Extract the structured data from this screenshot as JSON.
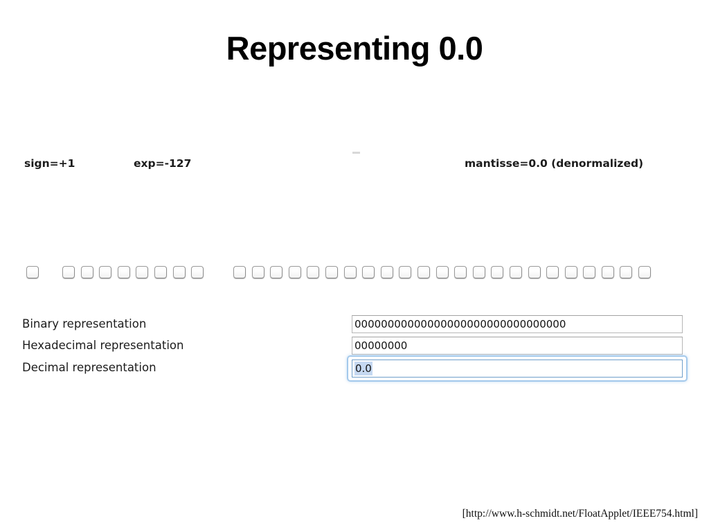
{
  "slide": {
    "title": "Representing 0.0",
    "source_note": "[http://www.h-schmidt.net/FloatApplet/IEEE754.html]"
  },
  "applet": {
    "field_labels": {
      "sign": "sign=+1",
      "exponent": "exp=-127",
      "mantissa": "mantisse=0.0 (denormalized)"
    },
    "bits": {
      "sign_count": 1,
      "exponent_count": 8,
      "mantissa_count": 23,
      "sign_values": [
        0
      ],
      "exponent_values": [
        0,
        0,
        0,
        0,
        0,
        0,
        0,
        0
      ],
      "mantissa_values": [
        0,
        0,
        0,
        0,
        0,
        0,
        0,
        0,
        0,
        0,
        0,
        0,
        0,
        0,
        0,
        0,
        0,
        0,
        0,
        0,
        0,
        0,
        0
      ]
    },
    "representations": [
      {
        "label": "Binary representation",
        "value": "00000000000000000000000000000000"
      },
      {
        "label": "Hexadecimal representation",
        "value": "00000000"
      },
      {
        "label": "Decimal representation",
        "value": "0.0"
      }
    ],
    "focus": {
      "focused_field": "Decimal representation",
      "selection_text": "0.0",
      "focus_ring_color": "#78afe2",
      "selection_color": "#c5d8f1"
    }
  }
}
